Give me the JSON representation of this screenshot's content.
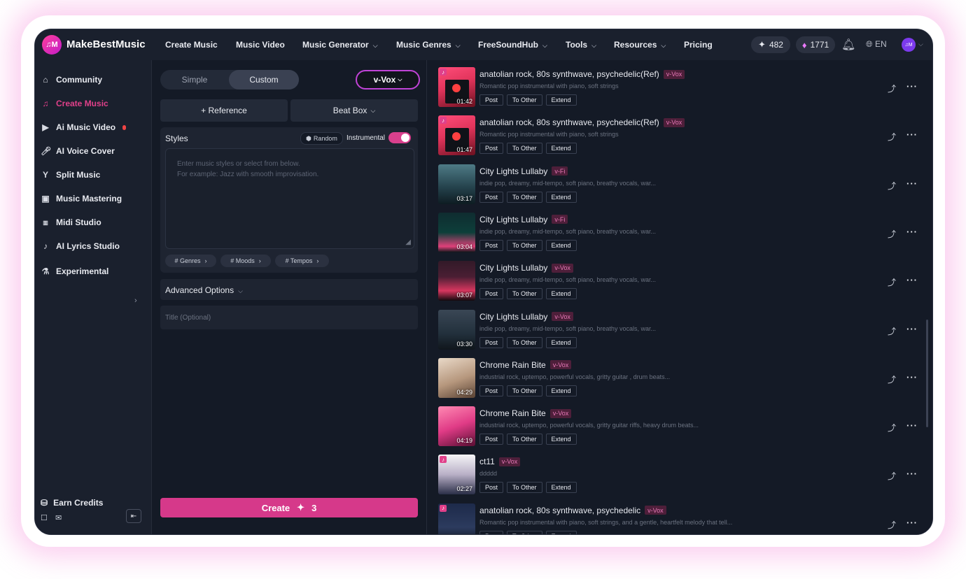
{
  "header": {
    "logo_text": "♫M",
    "brand": "MakeBestMusic",
    "nav": [
      "Create Music",
      "Music Video",
      "Music Generator",
      "Music Genres",
      "FreeSoundHub",
      "Tools",
      "Resources",
      "Pricing"
    ],
    "credits": "482",
    "gems": "1771",
    "lang": "EN",
    "avatar_text": "♫M"
  },
  "sidebar": {
    "items": [
      "Community",
      "Create Music",
      "Ai Music Video",
      "AI Voice Cover",
      "Split Music",
      "Music Mastering",
      "Midi Studio",
      "AI Lyrics Studio",
      "Experimental"
    ],
    "earn": "Earn Credits"
  },
  "panel": {
    "modes": [
      "Simple",
      "Custom"
    ],
    "model": "v-Vox",
    "reference": "+ Reference",
    "beatbox": "Beat Box",
    "styles_title": "Styles",
    "random": "Random",
    "instrumental": "Instrumental",
    "placeholder1": "Enter music styles or select from below.",
    "placeholder2": "For example: Jazz with smooth improvisation.",
    "tags": [
      "# Genres",
      "# Moods",
      "# Tempos"
    ],
    "advanced": "Advanced Options",
    "title_placeholder": "Title (Optional)",
    "create": "Create",
    "create_cost": "3"
  },
  "buttons": {
    "post": "Post",
    "to_other": "To Other",
    "extend": "Extend"
  },
  "songs": [
    {
      "title": "anatolian rock, 80s synthwave, psychedelic(Ref)",
      "badge": "v-Vox",
      "desc": "Romantic pop instrumental with piano, soft strings",
      "duration": "01:42"
    },
    {
      "title": "anatolian rock, 80s synthwave, psychedelic(Ref)",
      "badge": "v-Vox",
      "desc": "Romantic pop instrumental with piano, soft strings",
      "duration": "01:47"
    },
    {
      "title": "City Lights Lullaby",
      "badge": "v-Fi",
      "desc": "indie pop, dreamy, mid-tempo, soft piano, breathy vocals, war...",
      "duration": "03:17"
    },
    {
      "title": "City Lights Lullaby",
      "badge": "v-Fi",
      "desc": "indie pop, dreamy, mid-tempo, soft piano, breathy vocals, war...",
      "duration": "03:04"
    },
    {
      "title": "City Lights Lullaby",
      "badge": "v-Vox",
      "desc": "indie pop, dreamy, mid-tempo, soft piano, breathy vocals, war...",
      "duration": "03:07"
    },
    {
      "title": "City Lights Lullaby",
      "badge": "v-Vox",
      "desc": "indie pop, dreamy, mid-tempo, soft piano, breathy vocals, war...",
      "duration": "03:30"
    },
    {
      "title": "Chrome Rain Bite",
      "badge": "v-Vox",
      "desc": "industrial rock, uptempo, powerful vocals, gritty guitar         , drum beats...",
      "duration": "04:29"
    },
    {
      "title": "Chrome Rain Bite",
      "badge": "v-Vox",
      "desc": "industrial rock, uptempo, powerful vocals, gritty guitar riffs, heavy drum beats...",
      "duration": "04:19"
    },
    {
      "title": "ct11",
      "badge": "v-Vox",
      "desc": "ddddd",
      "duration": "02:27"
    },
    {
      "title": "anatolian rock, 80s synthwave, psychedelic",
      "badge": "v-Vox",
      "desc": "Romantic pop instrumental with piano, soft strings, and a gentle, heartfelt melody that tell...",
      "duration": ""
    }
  ]
}
